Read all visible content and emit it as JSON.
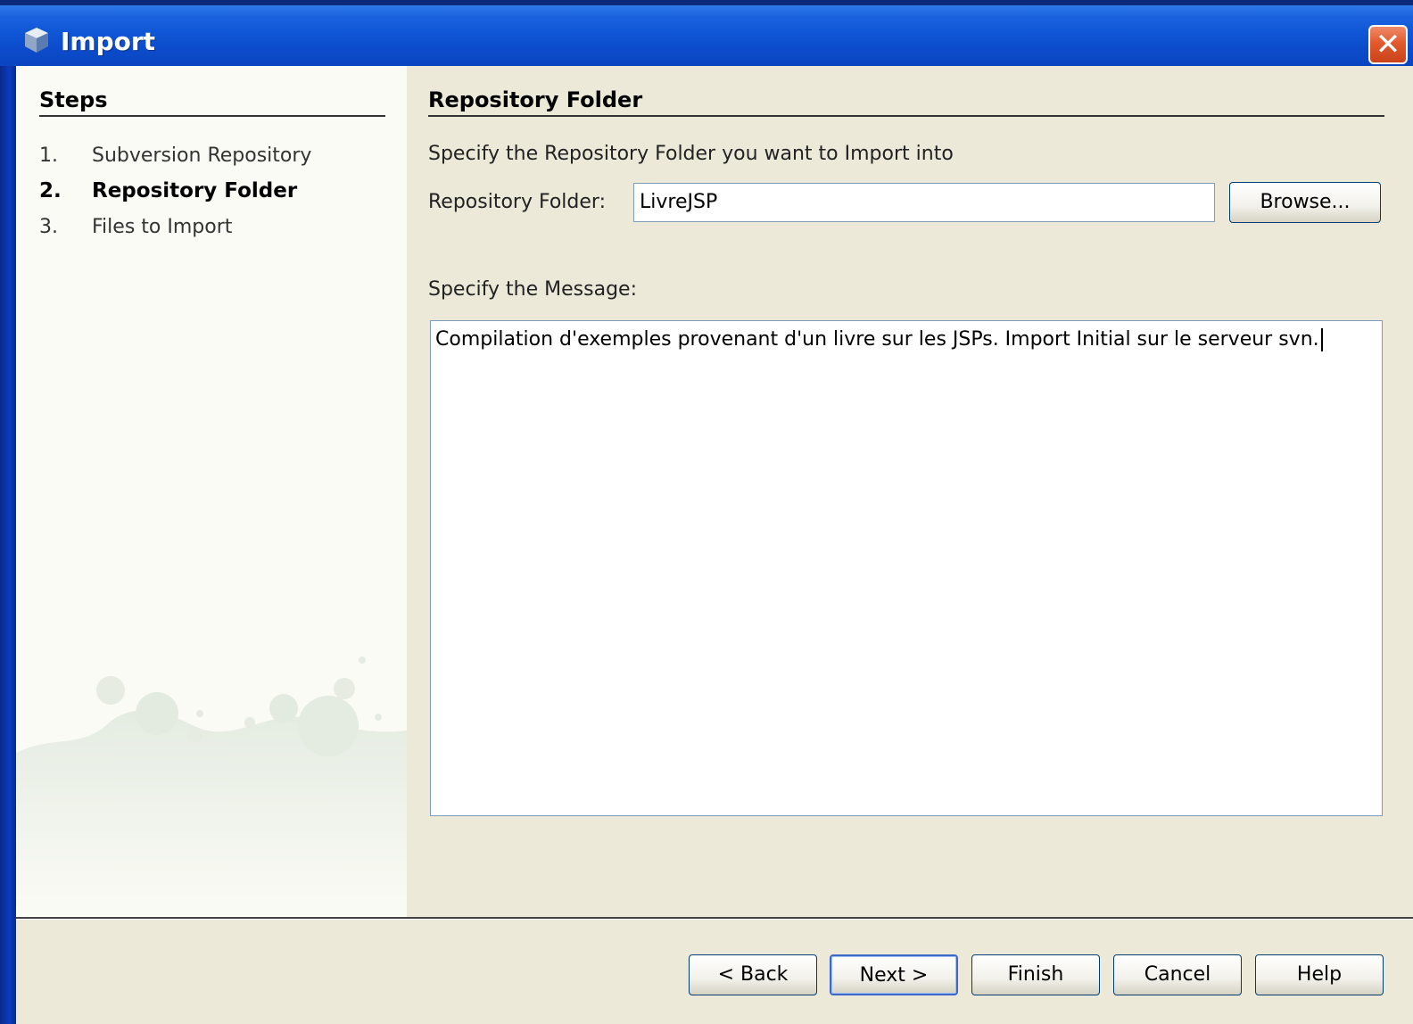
{
  "window": {
    "title": "Import",
    "close_symbol": "✕"
  },
  "steps": {
    "title": "Steps",
    "items": [
      {
        "num": "1.",
        "label": "Subversion Repository"
      },
      {
        "num": "2.",
        "label": "Repository Folder"
      },
      {
        "num": "3.",
        "label": "Files to Import"
      }
    ],
    "active_index": 1
  },
  "panel": {
    "title": "Repository Folder",
    "description": "Specify the Repository Folder you want to Import into",
    "folder_label": "Repository Folder:",
    "folder_value": "LivreJSP",
    "browse_label": "Browse...",
    "message_label": "Specify the Message:",
    "message_value": "Compilation d'exemples provenant d'un livre sur les JSPs. Import Initial sur le serveur svn."
  },
  "buttons": {
    "back": "< Back",
    "next": "Next >",
    "finish": "Finish",
    "cancel": "Cancel",
    "help": "Help"
  },
  "colors": {
    "titlebar": "#0c4ccc",
    "dialog_bg": "#ece9d8",
    "steps_bg": "#fbfbf5",
    "close_button": "#e25a2d"
  },
  "icons": {
    "title": "cube-icon",
    "close": "close-icon"
  }
}
